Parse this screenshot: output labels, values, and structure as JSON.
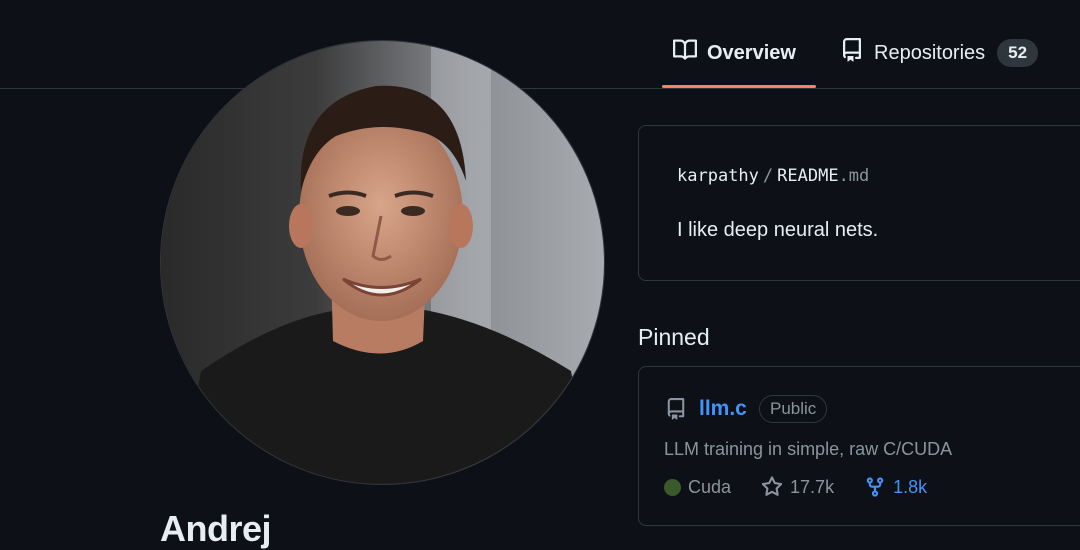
{
  "tabs": [
    {
      "label": "Overview",
      "icon": "book-icon",
      "active": true
    },
    {
      "label": "Repositories",
      "icon": "repo-icon",
      "count": "52"
    }
  ],
  "profile": {
    "name": "Andrej",
    "avatar": "profile-photo"
  },
  "readme": {
    "owner": "karpathy",
    "separator": "/",
    "file_base": "README",
    "file_ext": ".md",
    "text": "I like deep neural nets."
  },
  "pinned": {
    "title": "Pinned",
    "items": [
      {
        "name": "llm.c",
        "visibility": "Public",
        "description": "LLM training in simple, raw C/CUDA",
        "language": "Cuda",
        "language_color": "#3a5a2c",
        "stars": "17.7k",
        "forks": "1.8k"
      }
    ]
  },
  "colors": {
    "background": "#0d1117",
    "border": "#30363d",
    "accent_underline": "#f78166",
    "link": "#4493f8",
    "muted": "#8b949e"
  }
}
